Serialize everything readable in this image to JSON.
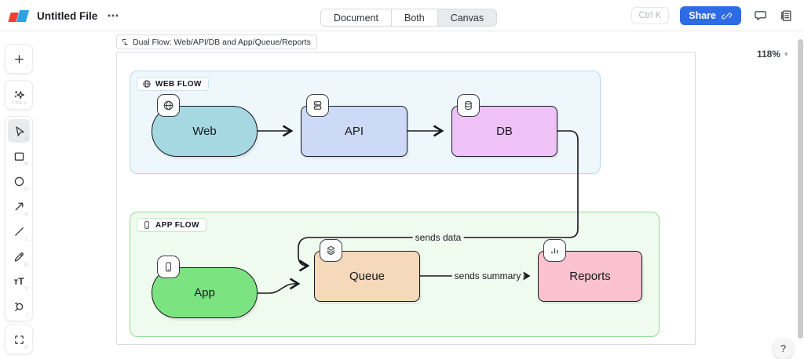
{
  "header": {
    "title": "Untitled File",
    "tabs": [
      {
        "label": "Document",
        "active": false
      },
      {
        "label": "Both",
        "active": false
      },
      {
        "label": "Canvas",
        "active": true
      }
    ],
    "shortcut_hint": "Ctrl K",
    "share_label": "Share",
    "accent_color": "#2e6be5"
  },
  "icons": {
    "ellipsis": "⋯",
    "caret_down": "▾",
    "text_tool": "тT"
  },
  "toolbar": {
    "items": [
      {
        "name": "insert",
        "icon": "plus-icon",
        "shortcut": "/"
      },
      {
        "name": "ai",
        "icon": "sparkle-icon",
        "shortcut": "CTRL J"
      },
      {
        "name": "select",
        "icon": "cursor-icon",
        "shortcut": "V",
        "active": true
      },
      {
        "name": "rectangle",
        "icon": "rectangle-icon",
        "shortcut": "R"
      },
      {
        "name": "ellipse",
        "icon": "ellipse-icon",
        "shortcut": "O"
      },
      {
        "name": "arrow",
        "icon": "arrow-icon",
        "shortcut": "A"
      },
      {
        "name": "line",
        "icon": "line-icon",
        "shortcut": "L"
      },
      {
        "name": "draw",
        "icon": "pencil-icon",
        "shortcut": "D"
      },
      {
        "name": "text",
        "icon": "text-icon",
        "shortcut": "T"
      },
      {
        "name": "ai-search",
        "icon": "sparkle-search-icon",
        "shortcut": "I"
      },
      {
        "name": "frame",
        "icon": "frame-icon",
        "shortcut": "F"
      }
    ]
  },
  "canvas": {
    "frame_title": "Dual Flow: Web/API/DB and App/Queue/Reports",
    "zoom_level": "118%",
    "help_label": "?",
    "containers": [
      {
        "label": "WEB FLOW",
        "icon": "globe-icon",
        "fill": "#eef7fc",
        "border": "#b5daee"
      },
      {
        "label": "APP FLOW",
        "icon": "phone-icon",
        "fill": "#f0fbf0",
        "border": "#94dd94"
      }
    ],
    "nodes": [
      {
        "label": "Web",
        "icon": "globe-icon",
        "shape": "stadium",
        "fill": "#a6d8e2"
      },
      {
        "label": "API",
        "icon": "server-icon",
        "shape": "rectangle",
        "fill": "#ccdaf7"
      },
      {
        "label": "DB",
        "icon": "database-icon",
        "shape": "rectangle",
        "fill": "#eec2f6"
      },
      {
        "label": "App",
        "icon": "phone-icon",
        "shape": "stadium",
        "fill": "#7ce381"
      },
      {
        "label": "Queue",
        "icon": "layers-icon",
        "shape": "rectangle",
        "fill": "#f6d8ba"
      },
      {
        "label": "Reports",
        "icon": "chart-icon",
        "shape": "rectangle",
        "fill": "#fac1ce"
      }
    ],
    "edges": [
      {
        "from": "Web",
        "to": "API",
        "label": ""
      },
      {
        "from": "API",
        "to": "DB",
        "label": ""
      },
      {
        "from": "DB",
        "to": "Queue",
        "label": "sends data"
      },
      {
        "from": "App",
        "to": "Queue",
        "label": ""
      },
      {
        "from": "Queue",
        "to": "Reports",
        "label": "sends summary"
      }
    ]
  }
}
